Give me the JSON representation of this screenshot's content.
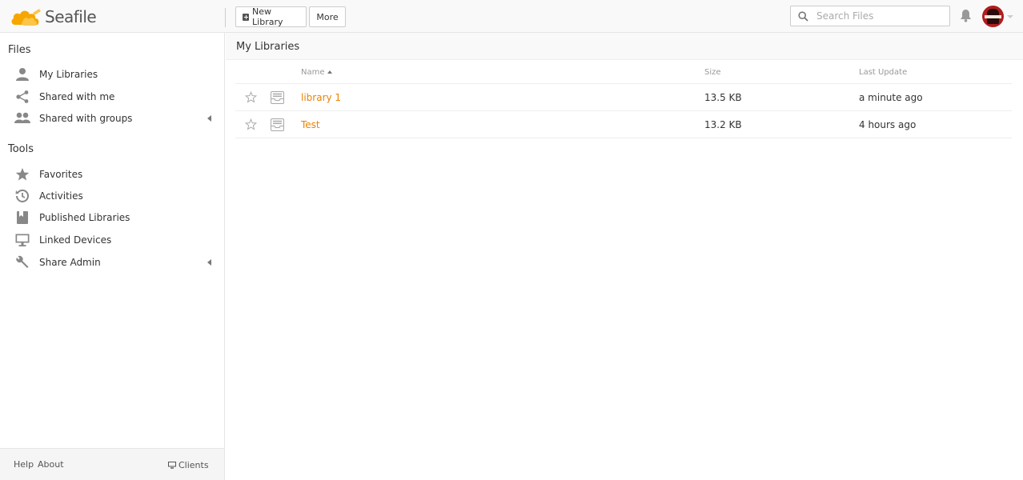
{
  "header": {
    "logo_text": "Seafile",
    "new_library_label": "New Library",
    "more_label": "More",
    "search_placeholder": "Search Files",
    "accent_color": "#eb8205"
  },
  "sidebar": {
    "files_title": "Files",
    "files_items": [
      {
        "label": "My Libraries",
        "icon": "user-icon"
      },
      {
        "label": "Shared with me",
        "icon": "share-icon"
      },
      {
        "label": "Shared with groups",
        "icon": "group-icon",
        "expandable": true
      }
    ],
    "tools_title": "Tools",
    "tools_items": [
      {
        "label": "Favorites",
        "icon": "star-icon"
      },
      {
        "label": "Activities",
        "icon": "history-icon"
      },
      {
        "label": "Published Libraries",
        "icon": "book-icon"
      },
      {
        "label": "Linked Devices",
        "icon": "monitor-icon"
      },
      {
        "label": "Share Admin",
        "icon": "wrench-icon",
        "expandable": true
      }
    ],
    "footer": {
      "help": "Help",
      "about": "About",
      "clients": "Clients"
    }
  },
  "main": {
    "title": "My Libraries",
    "columns": {
      "name": "Name",
      "size": "Size",
      "last_update": "Last Update"
    },
    "rows": [
      {
        "name": "library 1",
        "size": "13.5 KB",
        "last_update": "a minute ago"
      },
      {
        "name": "Test",
        "size": "13.2 KB",
        "last_update": "4 hours ago"
      }
    ]
  }
}
